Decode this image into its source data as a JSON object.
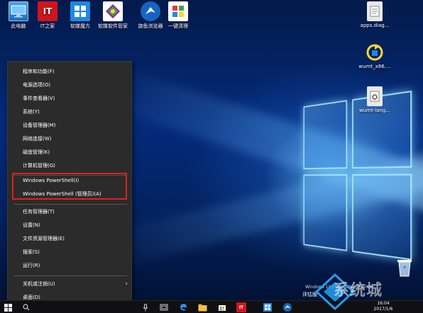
{
  "desktop_icons": [
    {
      "label": "此电脑",
      "icon": "this-pc-icon"
    },
    {
      "label": "IT之家",
      "icon": "it-home-icon",
      "glyph": "IT"
    },
    {
      "label": "软媒魔方",
      "icon": "ruanmei-mofang-icon"
    },
    {
      "label": "软媒软件管家",
      "icon": "software-manager-icon"
    },
    {
      "label": "旗鱼浏览器",
      "icon": "qiyu-browser-icon"
    },
    {
      "label": "一键清理",
      "icon": "one-click-clean-icon"
    },
    {
      "label": "apps.diag...",
      "icon": "file-icon"
    },
    {
      "label": "wumt_x86....",
      "icon": "wumt-icon"
    },
    {
      "label": "wumt-lang...",
      "icon": "settings-file-icon"
    }
  ],
  "context_menu": {
    "items": [
      "程序和功能(F)",
      "电源选项(O)",
      "事件查看器(V)",
      "系统(Y)",
      "设备管理器(M)",
      "网络连接(W)",
      "磁盘管理(K)",
      "计算机管理(G)",
      "Windows PowerShell(I)",
      "Windows PowerShell (管理员)(A)",
      "任务管理器(T)",
      "设置(N)",
      "文件资源管理器(E)",
      "搜索(S)",
      "运行(R)",
      "关机或注销(U)",
      "桌面(D)"
    ],
    "highlight_color": "#e02020"
  },
  "taskbar": {
    "time": "16:04",
    "date": "2017/1/6",
    "eval_text": "评估版"
  },
  "build_text": "Windows 10 Pro Insider Preview",
  "watermark": "系统城",
  "colors": {
    "menu_bg": "#2b2b2b",
    "taskbar_bg": "#101013",
    "accent": "#0a78d7"
  }
}
